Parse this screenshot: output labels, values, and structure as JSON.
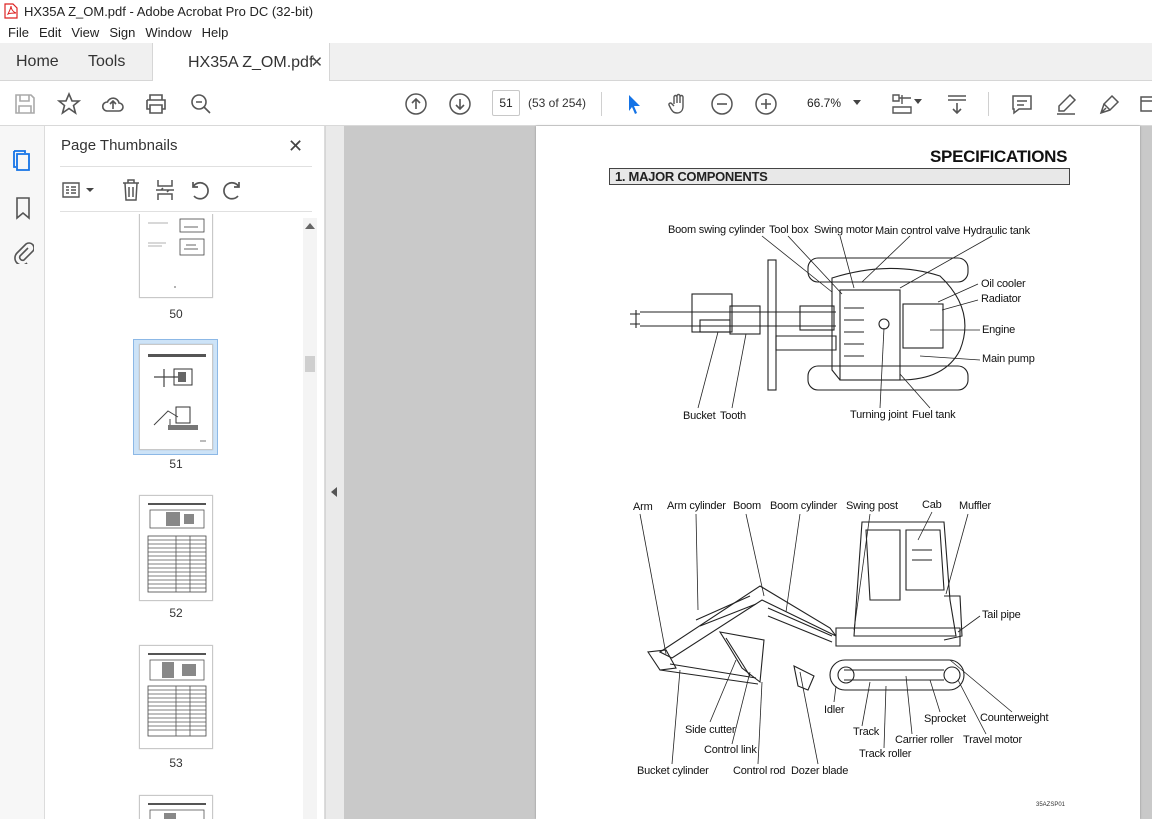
{
  "window": {
    "title": "HX35A Z_OM.pdf - Adobe Acrobat Pro DC (32-bit)"
  },
  "menu": [
    "File",
    "Edit",
    "View",
    "Sign",
    "Window",
    "Help"
  ],
  "tabs": {
    "home": "Home",
    "tools": "Tools",
    "document": "HX35A Z_OM.pdf"
  },
  "toolbar": {
    "page_number": "51",
    "page_count": "(53 of 254)",
    "zoom": "66.7%"
  },
  "panel": {
    "title": "Page Thumbnails",
    "thumbnails": [
      {
        "label": "50",
        "selected": false
      },
      {
        "label": "51",
        "selected": true
      },
      {
        "label": "52",
        "selected": false
      },
      {
        "label": "53",
        "selected": false
      }
    ]
  },
  "document": {
    "heading": "SPECIFICATIONS",
    "section": "1. MAJOR COMPONENTS",
    "top_view_labels": {
      "boom_swing_cylinder": "Boom swing cylinder",
      "tool_box": "Tool box",
      "swing_motor": "Swing motor",
      "main_control_valve": "Main control valve",
      "hydraulic_tank": "Hydraulic tank",
      "oil_cooler": "Oil cooler",
      "radiator": "Radiator",
      "engine": "Engine",
      "main_pump": "Main pump",
      "bucket": "Bucket",
      "tooth": "Tooth",
      "turning_joint": "Turning joint",
      "fuel_tank": "Fuel tank"
    },
    "side_view_labels": {
      "arm": "Arm",
      "arm_cylinder": "Arm cylinder",
      "boom": "Boom",
      "boom_cylinder": "Boom cylinder",
      "swing_post": "Swing post",
      "cab": "Cab",
      "muffler": "Muffler",
      "tail_pipe": "Tail pipe",
      "idler": "Idler",
      "counterweight": "Counterweight",
      "sprocket": "Sprocket",
      "side_cutter": "Side cutter",
      "track": "Track",
      "carrier_roller": "Carrier roller",
      "travel_motor": "Travel motor",
      "control_link": "Control link",
      "track_roller": "Track roller",
      "bucket_cylinder": "Bucket cylinder",
      "control_rod": "Control rod",
      "dozer_blade": "Dozer blade"
    },
    "figure_code": "35AZSP01"
  }
}
